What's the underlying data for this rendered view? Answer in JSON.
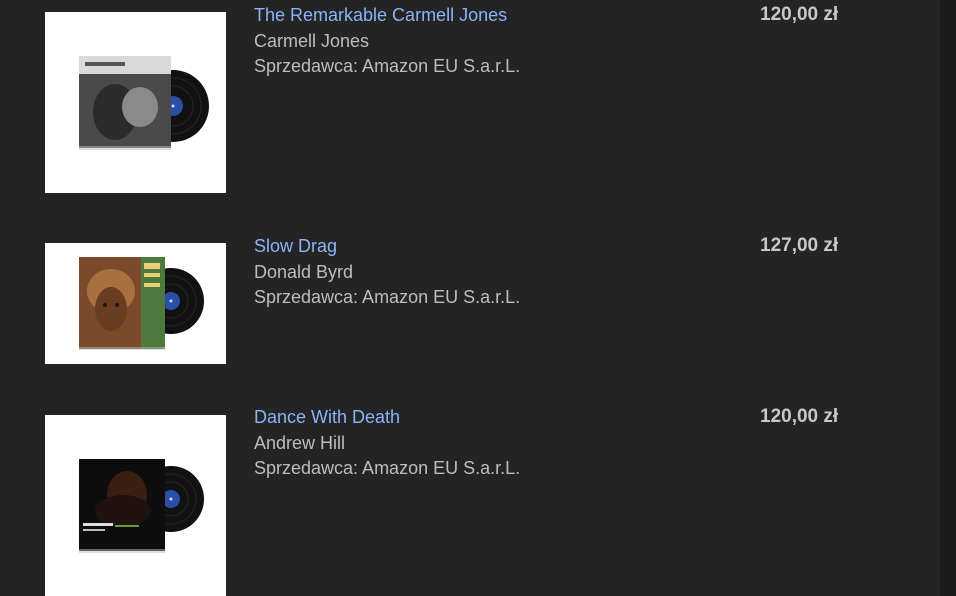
{
  "items": [
    {
      "title": "The Remarkable Carmell Jones",
      "artist": "Carmell Jones",
      "seller": "Sprzedawca: Amazon EU S.a.r.L.",
      "price": "120,00 zł",
      "icon": "vinyl-record-icon"
    },
    {
      "title": "Slow Drag",
      "artist": "Donald Byrd",
      "seller": "Sprzedawca: Amazon EU S.a.r.L.",
      "price": "127,00 zł",
      "icon": "vinyl-record-icon"
    },
    {
      "title": "Dance With Death",
      "artist": "Andrew Hill",
      "seller": "Sprzedawca: Amazon EU S.a.r.L.",
      "price": "120,00 zł",
      "icon": "vinyl-record-icon"
    }
  ],
  "colors": {
    "background": "#242424",
    "link": "#8ab4f8",
    "text": "#bdbdbd",
    "price": "#c8c8c8"
  }
}
